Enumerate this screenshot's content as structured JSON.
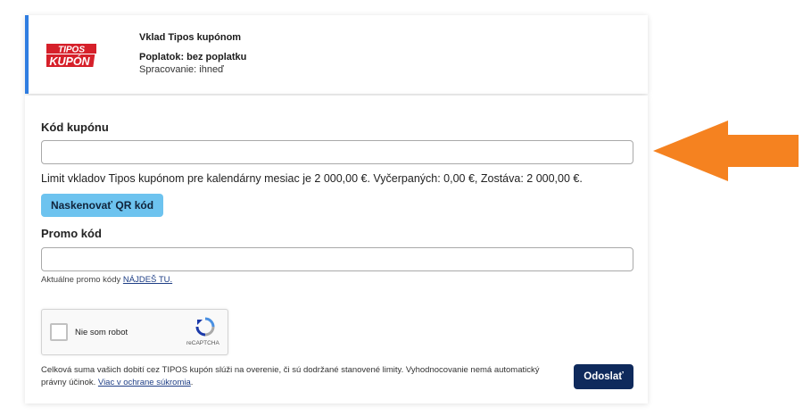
{
  "method": {
    "logo_line1": "TIPOS",
    "logo_line2": "KUPÓN",
    "title": "Vklad Tipos kupónom",
    "fee": "Poplatok: bez poplatku",
    "processing": "Spracovanie: ihneď"
  },
  "form": {
    "coupon_label": "Kód kupónu",
    "coupon_value": "",
    "limit_text": "Limit vkladov Tipos kupónom pre kalendárny mesiac je 2 000,00 €. Vyčerpaných: 0,00 €, Zostáva: 2 000,00 €.",
    "scan_button": "Naskenovať QR kód",
    "promo_label": "Promo kód",
    "promo_value": "",
    "promo_hint": "Aktuálne promo kódy",
    "promo_link": "NÁJDEŠ TU."
  },
  "captcha": {
    "label": "Nie som robot",
    "brand": "reCAPTCHA"
  },
  "footer": {
    "text": "Celková suma vašich dobití cez TIPOS kupón slúži na overenie, či sú dodržané stanovené limity. Vyhodnocovanie nemá automatický právny účinok.",
    "link": "Viac v ochrane súkromia",
    "send_button": "Odoslať"
  },
  "colors": {
    "accent_border": "#2f7de1",
    "scan_button": "#6dc3ef",
    "send_button": "#0f2a5c",
    "arrow": "#f58220",
    "logo_red": "#d6202a"
  }
}
